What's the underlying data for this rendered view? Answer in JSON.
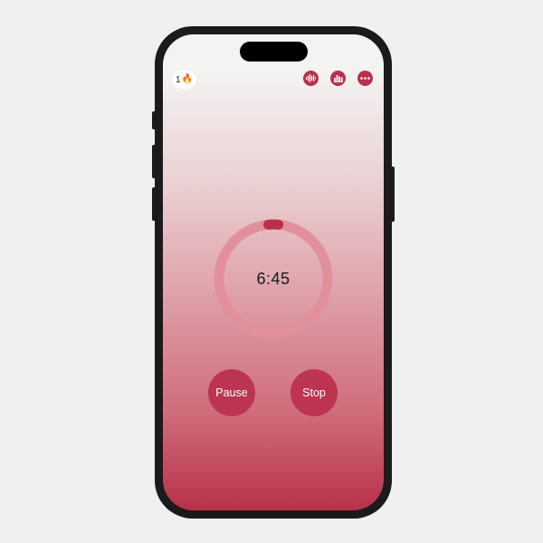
{
  "streak": {
    "count": "1",
    "icon": "fire-icon"
  },
  "toolbar": {
    "icons": [
      "waveform-icon",
      "bar-chart-icon",
      "more-icon"
    ],
    "accent": "#b8314b"
  },
  "timer": {
    "time": "6:45",
    "progress": 0.03
  },
  "controls": {
    "pause_label": "Pause",
    "stop_label": "Stop"
  },
  "colors": {
    "gradient_top": "#f3f3f2",
    "gradient_bottom": "#b8304a",
    "button": "#bc3450"
  }
}
